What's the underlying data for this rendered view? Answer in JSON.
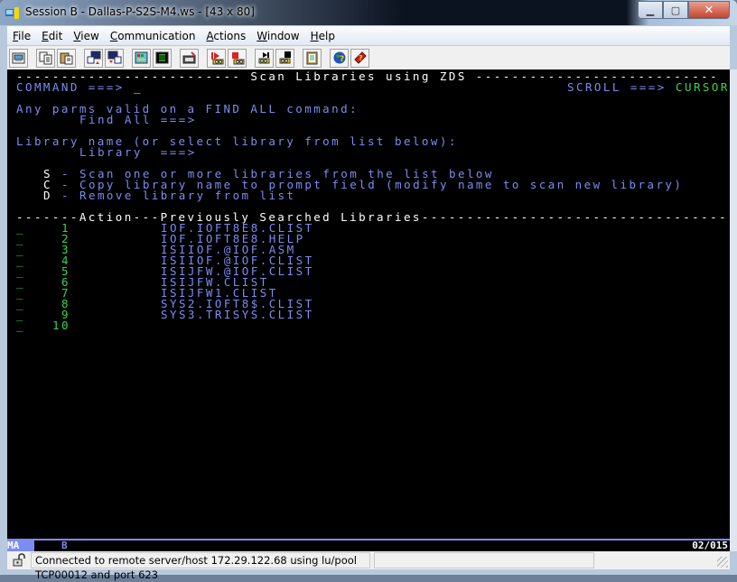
{
  "window": {
    "title": "Session B - Dallas-P-S2S-M4.ws - [43 x 80]",
    "controls": [
      "minimize",
      "maximize",
      "close"
    ]
  },
  "menubar": [
    {
      "label": "File",
      "accel": "F",
      "rest": "ile"
    },
    {
      "label": "Edit",
      "accel": "E",
      "rest": "dit"
    },
    {
      "label": "View",
      "accel": "V",
      "rest": "iew"
    },
    {
      "label": "Communication",
      "accel": "C",
      "rest": "ommunication"
    },
    {
      "label": "Actions",
      "accel": "A",
      "rest": "ctions"
    },
    {
      "label": "Window",
      "accel": "W",
      "rest": "indow"
    },
    {
      "label": "Help",
      "accel": "H",
      "rest": "elp"
    }
  ],
  "toolbar": [
    {
      "icon": "print-screen-icon"
    },
    {
      "icon": "copy-icon"
    },
    {
      "icon": "paste-icon"
    },
    {
      "icon": "send-file-icon"
    },
    {
      "icon": "receive-file-icon"
    },
    {
      "icon": "display-setup-icon"
    },
    {
      "icon": "color-setup-icon"
    },
    {
      "icon": "keyboard-map-icon"
    },
    {
      "icon": "play-macro-icon"
    },
    {
      "icon": "stop-macro-icon"
    },
    {
      "icon": "record-macro-icon"
    },
    {
      "icon": "stop-recording-icon"
    },
    {
      "icon": "clipboard-icon"
    },
    {
      "icon": "internet-help-icon"
    },
    {
      "icon": "help-book-icon"
    }
  ],
  "terminal": {
    "header_left": "------------------------- ",
    "header_title": "Scan Libraries using ZDS",
    "header_right": " ---------------------------",
    "command_label": "COMMAND ===>",
    "command_value": "_",
    "scroll_label": "SCROLL ===>",
    "scroll_value": "CURSOR",
    "find_prompt": "Any parms valid on a FIND ALL command:",
    "find_label": "Find All ===>",
    "library_prompt": "Library name (or select library from list below):",
    "library_label": "Library  ===>",
    "actions": [
      {
        "key": "S",
        "desc": "Scan one or more libraries from the list below"
      },
      {
        "key": "C",
        "desc": "Copy library name to prompt field (modify name to scan new library)"
      },
      {
        "key": "D",
        "desc": "Remove library from list"
      }
    ],
    "list_header": "-------Action---Previously Searched Libraries-----------------------------------",
    "list": [
      {
        "num": "1",
        "name": "IOF.IOFT8E8.CLIST"
      },
      {
        "num": "2",
        "name": "IOF.IOFT8E8.HELP"
      },
      {
        "num": "3",
        "name": "ISIIOF.@IOF.ASM"
      },
      {
        "num": "4",
        "name": "ISIIOF.@IOF.CLIST"
      },
      {
        "num": "5",
        "name": "ISIJFW.@IOF.CLIST"
      },
      {
        "num": "6",
        "name": "ISIJFW.CLIST"
      },
      {
        "num": "7",
        "name": "ISIJFW1.CLIST"
      },
      {
        "num": "8",
        "name": "SYS2.IOFT8$.CLIST"
      },
      {
        "num": "9",
        "name": "SYS3.TRISYS.CLIST"
      },
      {
        "num": "10",
        "name": ""
      }
    ]
  },
  "oia": {
    "indicator": "MA",
    "session": "B",
    "cursor_position": "02/015"
  },
  "statusbar": {
    "message": "Connected to remote server/host 172.29.122.68 using lu/pool TCP00012 and port 623"
  },
  "colors": {
    "field_blue": "#7b8cf2",
    "input_green": "#3dd24a",
    "text_white": "#ffffff",
    "terminal_bg": "#000000"
  }
}
